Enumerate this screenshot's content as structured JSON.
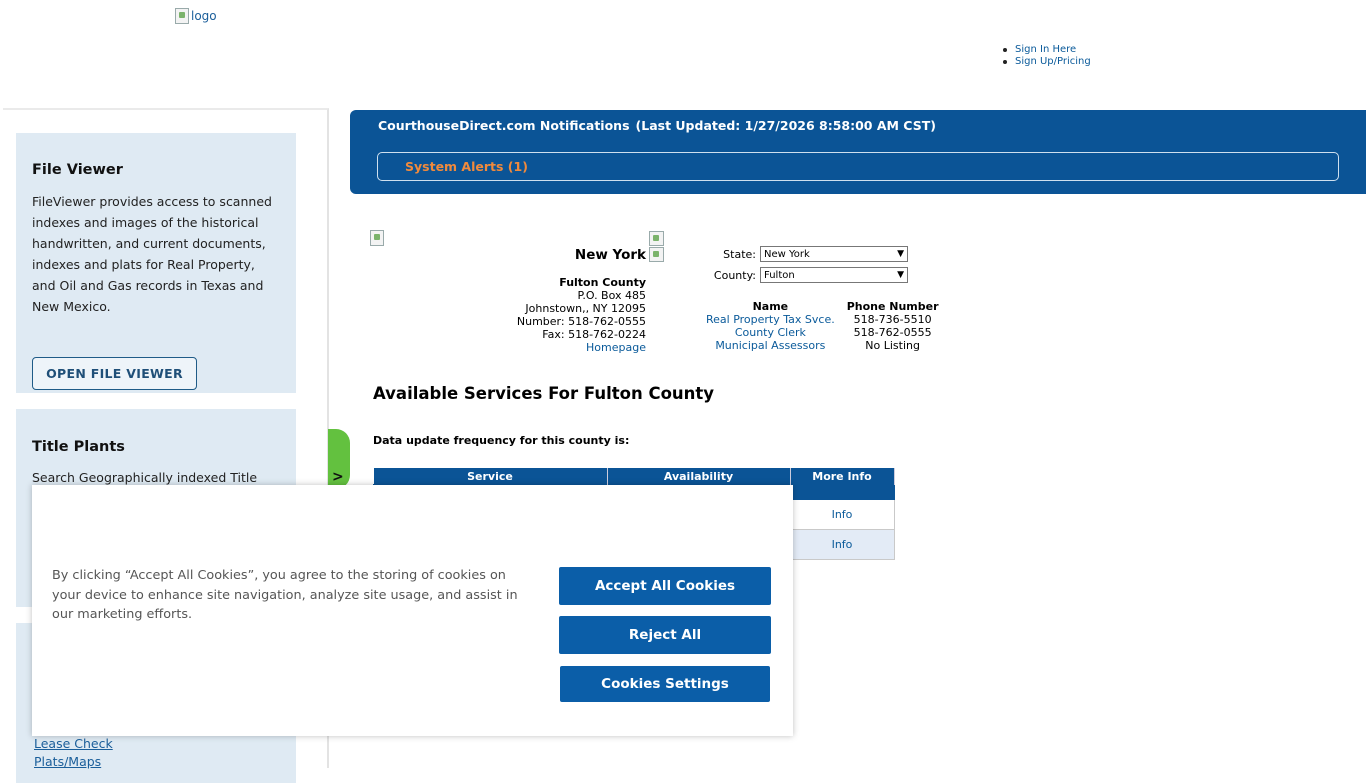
{
  "header": {
    "logo_alt": "logo",
    "links": [
      "Sign In Here",
      "Sign Up/Pricing"
    ]
  },
  "sidebar": {
    "file_viewer": {
      "title": "File Viewer",
      "text": "FileViewer provides access to scanned indexes and images of the historical handwritten, and current documents, indexes and plats for Real Property, and Oil and Gas records in Texas and New Mexico.",
      "button": "OPEN FILE VIEWER"
    },
    "title_plants": {
      "title": "Title Plants",
      "text": "Search Geographically indexed Title"
    },
    "links": [
      "Lease Check",
      "Plats/Maps"
    ],
    "tab_glyph": ">"
  },
  "notifications": {
    "title": "CourthouseDirect.com Notifications",
    "updated": "(Last Updated: 1/27/2026 8:58:00 AM CST)",
    "alerts": "System Alerts (1)"
  },
  "county": {
    "state_name": "New York",
    "county_name": "Fulton County",
    "address1": "P.O. Box 485",
    "address2": "Johnstown,, NY 12095",
    "number": "Number: 518-762-0555",
    "fax": "Fax: 518-762-0224",
    "homepage": "Homepage",
    "state_label": "State:",
    "state_value": "New York",
    "county_label": "County:",
    "county_value": "Fulton",
    "contacts_headers": [
      "Name",
      "Phone Number"
    ],
    "contacts": [
      {
        "name": "Real Property Tax Svce.",
        "phone": "518-736-5510"
      },
      {
        "name": "County Clerk",
        "phone": "518-762-0555"
      },
      {
        "name": "Municipal Assessors",
        "phone": "No Listing"
      }
    ]
  },
  "services": {
    "title": "Available Services For Fulton County",
    "frequency": "Data update frequency for this county is:",
    "headers": [
      "Service",
      "Availability",
      "More Info"
    ],
    "info_label": "Info"
  },
  "cookie": {
    "text": "By clicking “Accept All Cookies”, you agree to the storing of cookies on your device to enhance site navigation, analyze site usage, and assist in our marketing efforts.",
    "accept": "Accept All Cookies",
    "reject": "Reject All",
    "settings": "Cookies Settings"
  }
}
